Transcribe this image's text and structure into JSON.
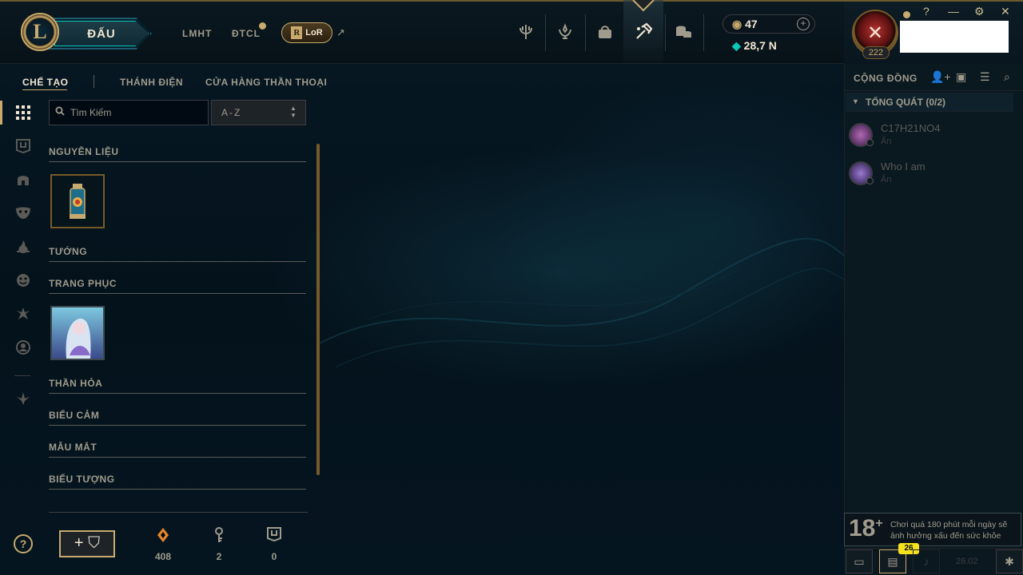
{
  "header": {
    "logo_letter": "L",
    "play_label": "ĐẤU",
    "nav": [
      "LMHT",
      "ĐTCL"
    ],
    "lor_label": "LoR",
    "lor_letter": "R",
    "external_icon": "external-link-icon",
    "icons": [
      "trident-icon",
      "award-icon",
      "backpack-icon",
      "crafting-hammer-icon",
      "coins-stack-icon"
    ],
    "wallet": {
      "rp": "47",
      "be": "28,7 N"
    }
  },
  "subnav": {
    "items": [
      "CHẾ TẠO",
      "THÁNH ĐIỆN",
      "CỬA HÀNG THẦN THOẠI"
    ],
    "active": 0
  },
  "sidebar_icons": [
    "grid-icon",
    "chest-icon",
    "helmet-icon",
    "mask-icon",
    "flame-icon",
    "emote-icon",
    "ward-icon",
    "profile-icon",
    "rune-icon"
  ],
  "search": {
    "placeholder": "Tìm Kiếm",
    "value": ""
  },
  "sort": {
    "value": "A-Z"
  },
  "categories": [
    {
      "title": "NGUYÊN LIỆU",
      "items": [
        "lantern-chest"
      ]
    },
    {
      "title": "TƯỚNG",
      "items": []
    },
    {
      "title": "TRANG PHỤC",
      "items": [
        "skin-portrait"
      ]
    },
    {
      "title": "THẦN HỎA",
      "items": []
    },
    {
      "title": "BIỂU CẢM",
      "items": []
    },
    {
      "title": "MẪU MẮT",
      "items": []
    },
    {
      "title": "BIỂU TƯỢNG",
      "items": []
    }
  ],
  "footer": {
    "help": "?",
    "craft_plus": "+",
    "resources": [
      {
        "icon": "orange-essence-icon",
        "value": "408"
      },
      {
        "icon": "key-fragment-icon",
        "value": "2"
      },
      {
        "icon": "chest-icon",
        "value": "0"
      }
    ]
  },
  "profile": {
    "level": "222",
    "window_buttons": [
      "?",
      "—",
      "⚙",
      "✕"
    ]
  },
  "social": {
    "title": "CỘNG ĐỒNG",
    "group": "TỔNG QUÁT (0/2)",
    "friends": [
      {
        "name": "C17H21NO4",
        "status": "Ẩn"
      },
      {
        "name": "Who I am",
        "status": "Ẩn"
      }
    ],
    "age_rating": "18",
    "age_plus": "+",
    "warning": "Chơi quá 180 phút mỗi ngày sẽ ảnh hưởng xấu đến sức khỏe",
    "notification_count": "26",
    "version": "26.02"
  },
  "colors": {
    "gold": "#c8aa6e",
    "dark_gold": "#785a28",
    "text": "#a09b8c",
    "bright": "#f0e6d2",
    "background": "#010a13"
  }
}
